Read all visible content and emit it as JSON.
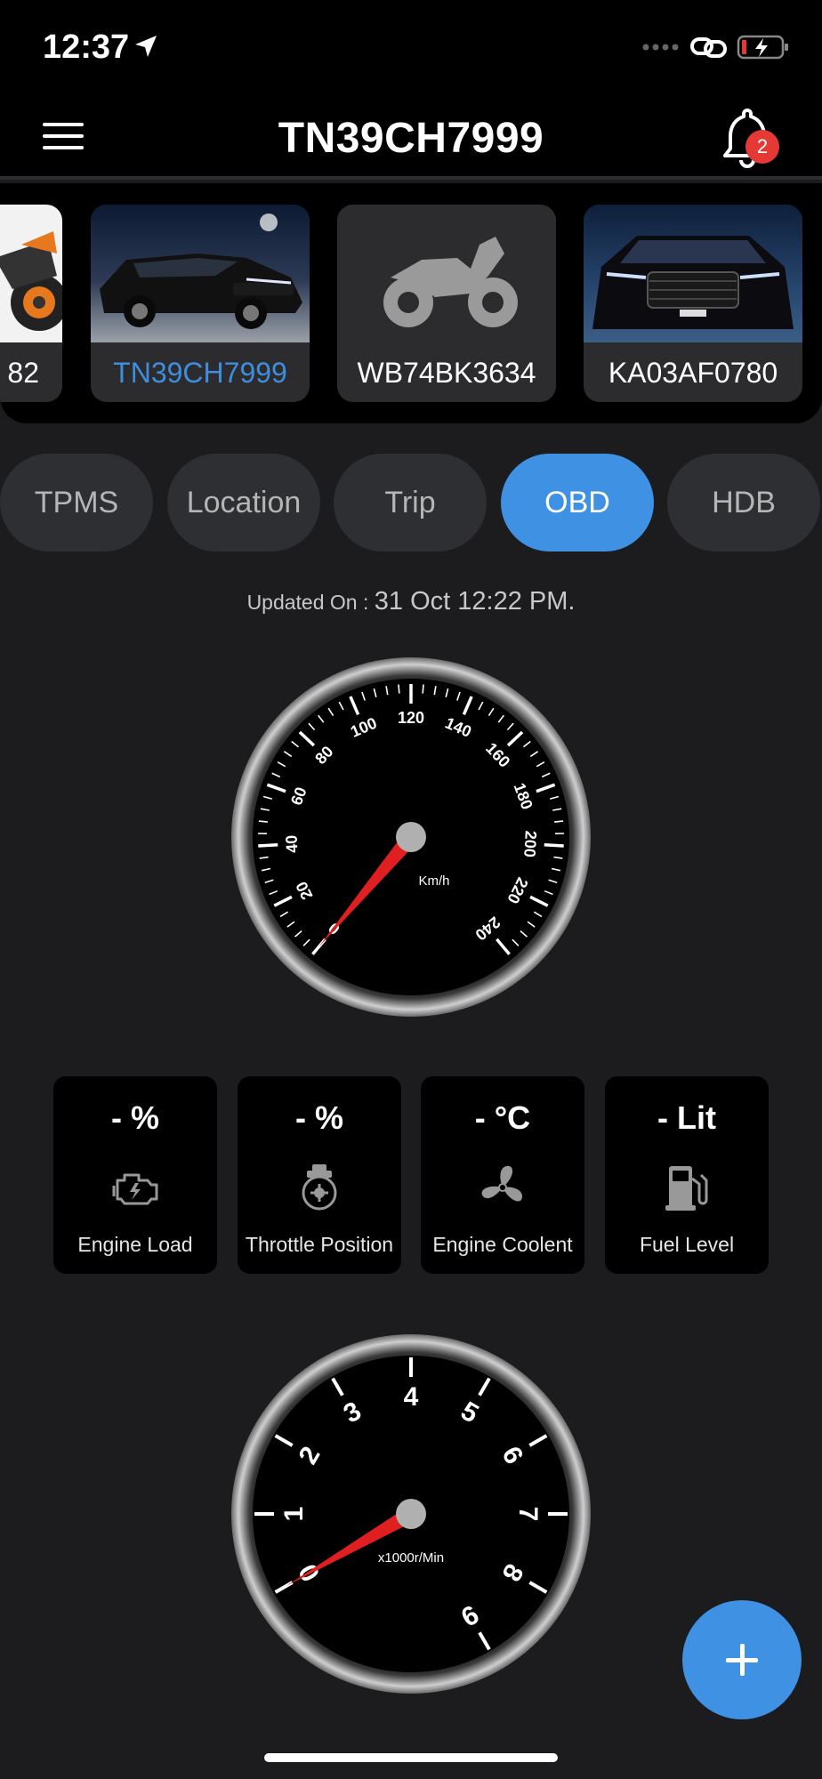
{
  "status_bar": {
    "time": "12:37"
  },
  "header": {
    "title": "TN39CH7999",
    "notification_count": "2"
  },
  "vehicles": [
    {
      "plate": "82",
      "image": "orange-bike-photo",
      "active": false
    },
    {
      "plate": "TN39CH7999",
      "image": "black-suv-photo",
      "active": true
    },
    {
      "plate": "WB74BK3634",
      "image": "motorcycle-icon",
      "active": false
    },
    {
      "plate": "KA03AF0780",
      "image": "creta-front-photo",
      "active": false
    }
  ],
  "tabs": [
    "TPMS",
    "Location",
    "Trip",
    "OBD",
    "HDB"
  ],
  "active_tab": "OBD",
  "updated": {
    "label": "Updated On : ",
    "value": "31 Oct 12:22 PM."
  },
  "speedometer": {
    "unit": "Km/h",
    "ticks": [
      "0",
      "20",
      "40",
      "60",
      "80",
      "100",
      "120",
      "140",
      "160",
      "180",
      "200",
      "220",
      "240"
    ],
    "value": 0
  },
  "metrics": [
    {
      "value": "- %",
      "label": "Engine Load",
      "icon": "engine-icon"
    },
    {
      "value": "- %",
      "label": "Throttle Position",
      "icon": "throttle-icon"
    },
    {
      "value": "- °C",
      "label": "Engine Coolent",
      "icon": "fan-icon"
    },
    {
      "value": "- Lit",
      "label": "Fuel Level",
      "icon": "fuel-pump-icon"
    }
  ],
  "tachometer": {
    "unit": "x1000r/Min",
    "ticks": [
      "0",
      "1",
      "2",
      "3",
      "4",
      "5",
      "6",
      "7",
      "8",
      "9"
    ],
    "value": 0
  },
  "colors": {
    "accent": "#3e91e3",
    "needle": "#e02020",
    "badge": "#e53935",
    "background": "#1c1c1e"
  }
}
